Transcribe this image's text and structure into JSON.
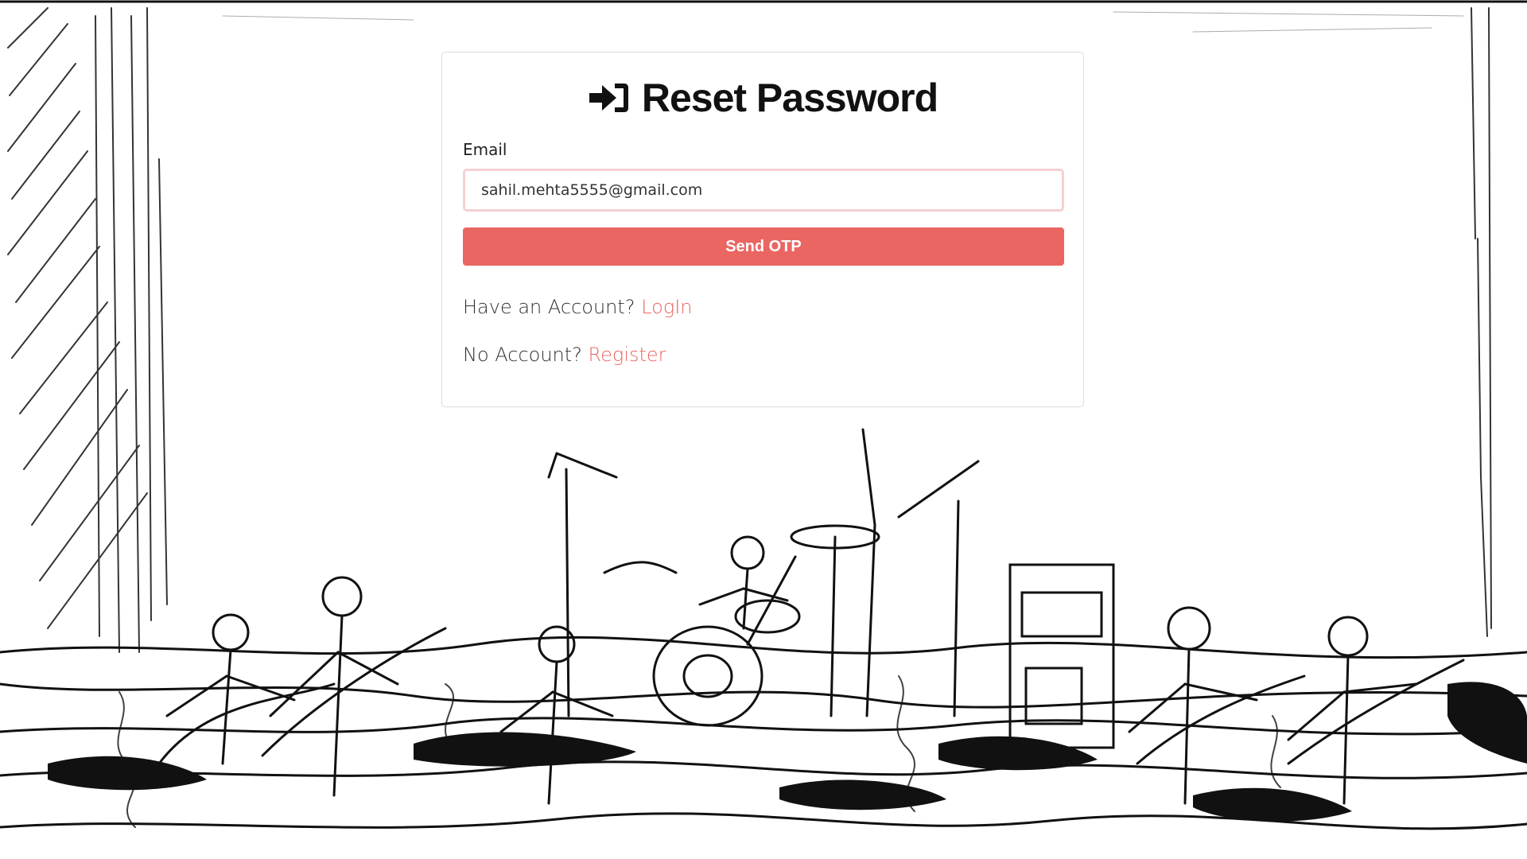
{
  "card": {
    "title": "Reset Password",
    "title_icon": "sign-in-icon"
  },
  "form": {
    "email_label": "Email",
    "email_value": "sahil.mehta5555@gmail.com",
    "send_button_label": "Send OTP"
  },
  "links": {
    "login_prompt": "Have an Account?",
    "login_label": "LogIn",
    "register_prompt": "No Account?",
    "register_label": "Register"
  },
  "colors": {
    "accent": "#ea6663",
    "input_border": "#f7cfd2"
  },
  "background": {
    "description_icon": "band-sketch-illustration"
  }
}
